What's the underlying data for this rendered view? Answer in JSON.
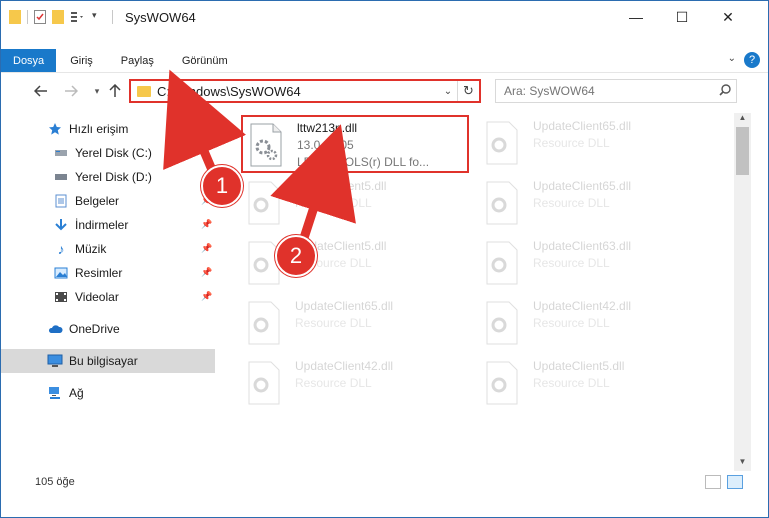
{
  "window": {
    "title": "SysWOW64"
  },
  "ribbon": {
    "tabs": [
      "Dosya",
      "Giriş",
      "Paylaş",
      "Görünüm"
    ]
  },
  "navbar": {
    "address": "C:\\Windows\\SysWOW64",
    "search_placeholder": "Ara: SysWOW64"
  },
  "sidebar": {
    "items": [
      {
        "label": "Hızlı erişim",
        "icon": "star-icon"
      },
      {
        "label": "Yerel Disk (C:)",
        "icon": "drive-icon"
      },
      {
        "label": "Yerel Disk (D:)",
        "icon": "drive-icon"
      },
      {
        "label": "Belgeler",
        "icon": "documents-icon"
      },
      {
        "label": "İndirmeler",
        "icon": "download-icon"
      },
      {
        "label": "Müzik",
        "icon": "music-icon"
      },
      {
        "label": "Resimler",
        "icon": "pictures-icon"
      },
      {
        "label": "Videolar",
        "icon": "videos-icon"
      },
      {
        "label": "OneDrive",
        "icon": "cloud-icon"
      },
      {
        "label": "Bu bilgisayar",
        "icon": "computer-icon"
      },
      {
        "label": "Ağ",
        "icon": "network-icon"
      }
    ]
  },
  "files": {
    "main": {
      "name": "lttw213n.dll",
      "version": "13.0.0.105",
      "desc": "LEADTOOLS(r) DLL fo..."
    },
    "background": [
      {
        "name": "UpdateClient65.dll",
        "desc": "Resource DLL"
      },
      {
        "name": "UpdateClient5.dll",
        "desc": "Resource DLL"
      },
      {
        "name": "UpdateClient65.dll",
        "desc": "Resource DLL"
      },
      {
        "name": "UpdateClient5.dll",
        "desc": "Resource DLL"
      },
      {
        "name": "UpdateClient63.dll",
        "desc": "Resource DLL"
      },
      {
        "name": "UpdateClient65.dll",
        "desc": "Resource DLL"
      },
      {
        "name": "UpdateClient42.dll",
        "desc": "Resource DLL"
      },
      {
        "name": "UpdateClient42.dll",
        "desc": "Resource DLL"
      },
      {
        "name": "UpdateClient5.dll",
        "desc": "Resource DLL"
      }
    ]
  },
  "status": {
    "item_count": "105 öğe"
  },
  "annotations": {
    "step1": "1",
    "step2": "2"
  },
  "colors": {
    "accent": "#1979ca",
    "highlight": "#e0322b",
    "folder": "#f6c84b"
  }
}
